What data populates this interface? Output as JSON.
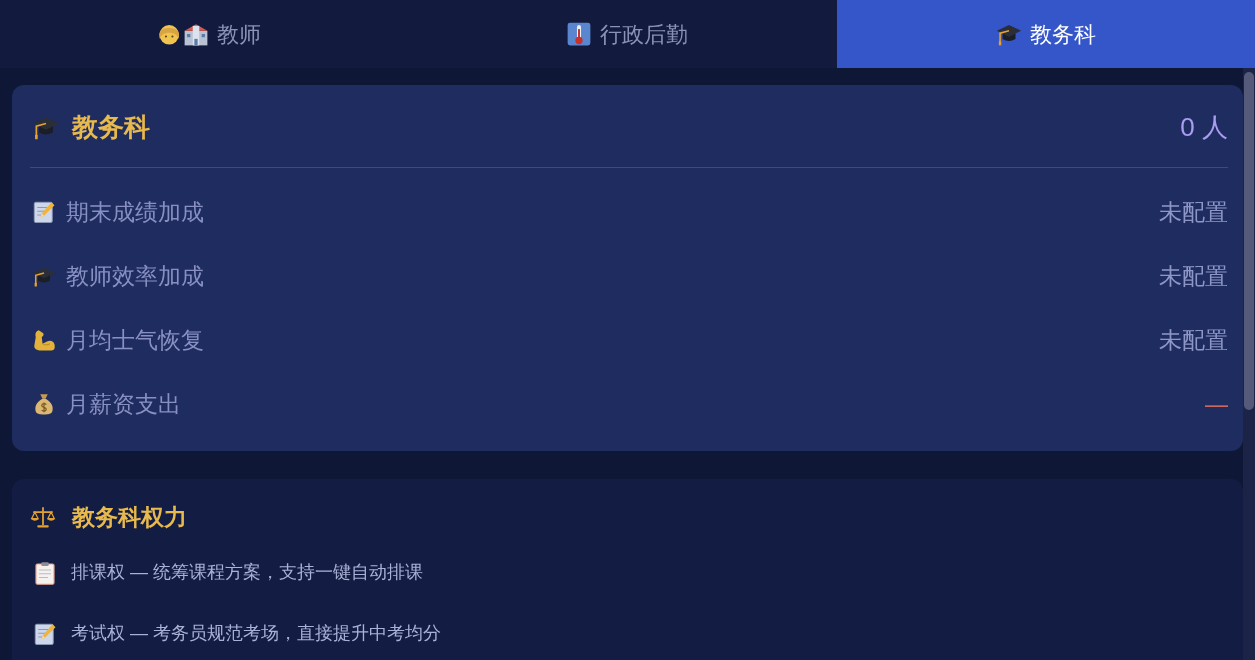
{
  "tabs": [
    {
      "label": "教师",
      "selected": false
    },
    {
      "label": "行政后勤",
      "selected": false
    },
    {
      "label": "教务科",
      "selected": true
    }
  ],
  "department": {
    "title": "教务科",
    "headcount": "0 人",
    "stats": [
      {
        "label": "期末成绩加成",
        "value": "未配置",
        "color": "#8e96c6"
      },
      {
        "label": "教师效率加成",
        "value": "未配置",
        "color": "#8e96c6"
      },
      {
        "label": "月均士气恢复",
        "value": "未配置",
        "color": "#8e96c6"
      },
      {
        "label": "月薪资支出",
        "value": "—",
        "color": "#d0675c"
      }
    ]
  },
  "powers": {
    "title": "教务科权力",
    "items": [
      {
        "text": "排课权 — 统筹课程方案，支持一键自动排课"
      },
      {
        "text": "考试权 — 考务员规范考场，直接提升中考均分"
      }
    ]
  }
}
